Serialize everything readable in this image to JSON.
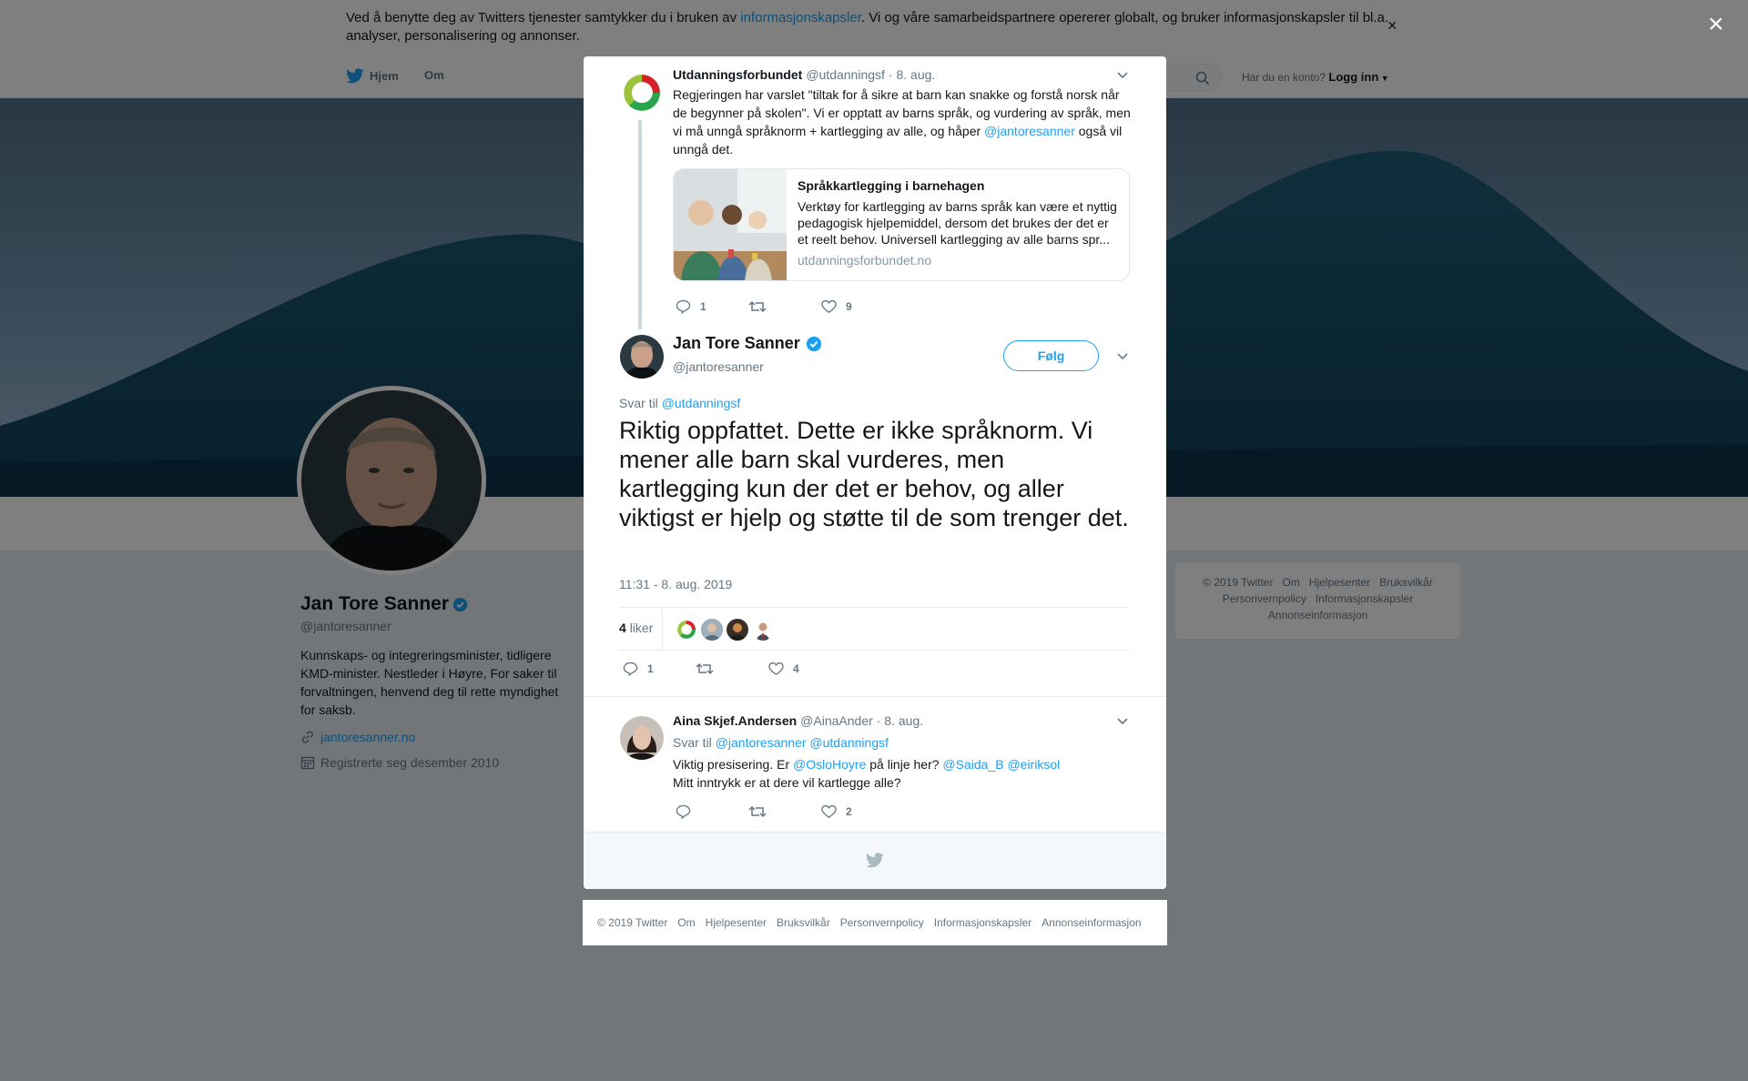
{
  "cookie_bar": {
    "text_before": "Ved å benytte deg av Twitters tjenester samtykker du i bruken av ",
    "link": "informasjonskapsler",
    "text_after": ". Vi og våre samarbeidspartnere opererer globalt, og bruker informasjonskapsler til bl.a. analyser, personalisering og annonser.",
    "close": "×"
  },
  "nav": {
    "home": "Hjem",
    "about": "Om",
    "account_prompt": "Har du en konto?",
    "login": "Logg inn"
  },
  "profile": {
    "name": "Jan Tore Sanner",
    "handle": "@jantoresanner",
    "bio": "Kunnskaps- og integreringsminister, tidligere KMD-minister. Nestleder i Høyre, For saker til forvaltningen, henvend deg til rette myndighet for saksb.",
    "website": "jantoresanner.no",
    "joined": "Registrerte seg desember 2010"
  },
  "side_footer": {
    "links": [
      "© 2019 Twitter",
      "Om",
      "Hjelpesenter",
      "Bruksvilkår",
      "Personvernpolicy",
      "Informasjonskapsler",
      "Annonseinformasjon"
    ]
  },
  "modal": {
    "close": "×",
    "parent_tweet": {
      "name": "Utdanningsforbundet",
      "handle": "@utdanningsf",
      "date": "· 8. aug.",
      "text": "Regjeringen har varslet \"tiltak for å sikre at barn kan snakke og forstå norsk når de begynner på skolen\". Vi er opptatt av barns språk, og vurdering av språk, men vi må unngå språknorm + kartlegging av alle, og håper ",
      "mention": "@jantoresanner",
      "text_end": " også vil unngå det.",
      "card": {
        "title": "Språkkartlegging i barnehagen",
        "description": "Verktøy for kartlegging av barns språk kan være et nyttig pedagogisk hjelpemiddel, dersom det brukes der det er et reelt behov. Universell kartlegging av alle barns spr...",
        "domain": "utdanningsforbundet.no"
      },
      "replies": "1",
      "retweets": "",
      "likes": "9"
    },
    "main_tweet": {
      "name": "Jan Tore Sanner",
      "handle": "@jantoresanner",
      "follow": "Følg",
      "reply_to_label": "Svar til",
      "reply_to": "@utdanningsf",
      "text": "Riktig oppfattet. Dette er ikke språknorm. Vi mener alle barn skal vurderes, men kartlegging kun der det er behov, og aller viktigst er hjelp og støtte til de som trenger det.",
      "time": "11:31 - 8. aug. 2019",
      "likes_count": "4",
      "likes_label": "liker",
      "replies": "1",
      "retweets": "",
      "likes": "4"
    },
    "reply_tweet": {
      "name": "Aina Skjef.Andersen",
      "handle": "@AinaAnder",
      "date": "· 8. aug.",
      "reply_to_label": "Svar til",
      "reply_to": "@jantoresanner @utdanningsf",
      "text_a": "Viktig presisering. Er ",
      "mention_a": "@OsloHoyre",
      "text_b": " på linje her? ",
      "mention_b": "@Saida_B @eiriksol",
      "text_c": "Mitt inntrykk er at dere vil kartlegge alle?",
      "replies": "",
      "retweets": "",
      "likes": "2"
    }
  },
  "bottom_footer": {
    "links": [
      "© 2019 Twitter",
      "Om",
      "Hjelpesenter",
      "Bruksvilkår",
      "Personvernpolicy",
      "Informasjonskapsler",
      "Annonseinformasjon"
    ]
  },
  "colors": {
    "brand": "#1da1f2",
    "verified": "#1da1f2",
    "overlay": "#000000"
  }
}
